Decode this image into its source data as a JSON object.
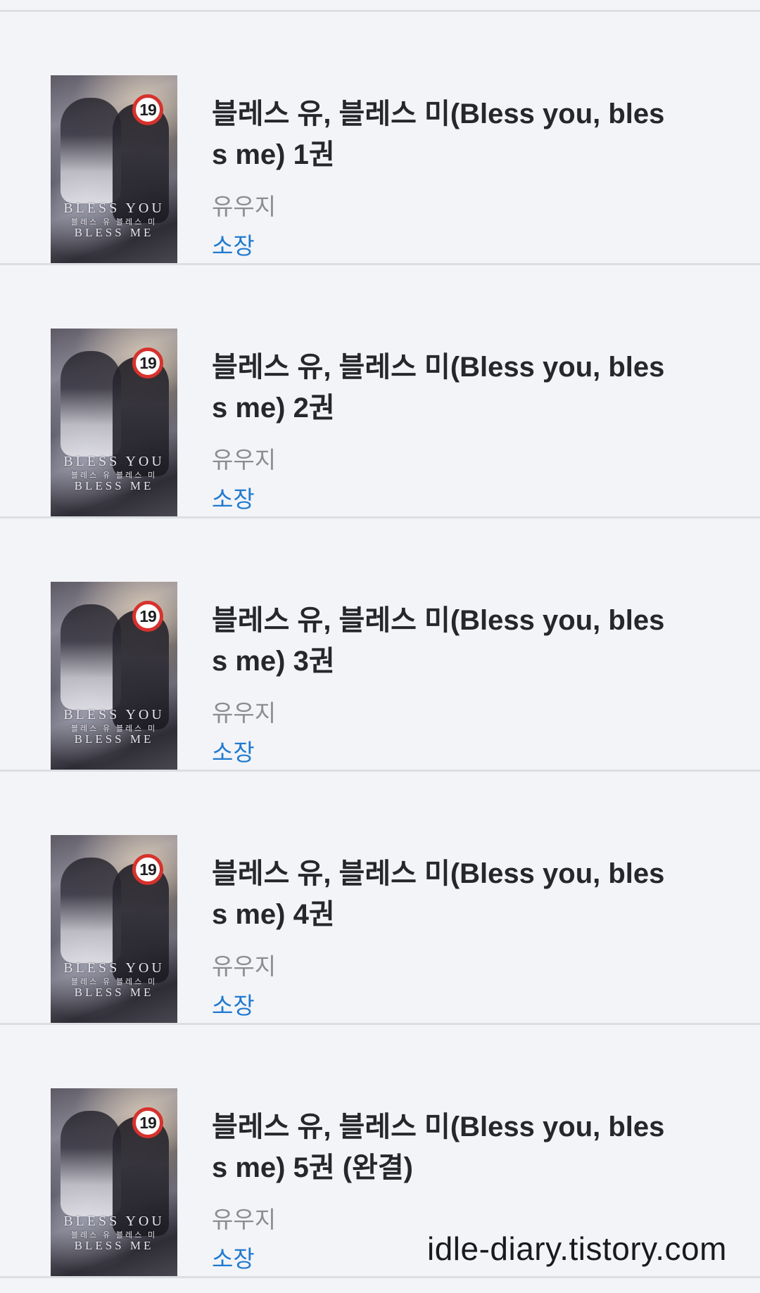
{
  "rating_badge": "19",
  "cover_text": {
    "title": "BLESS YOU",
    "subtitle": "블레스 유 블레스 미",
    "title2": "BLESS ME"
  },
  "books": [
    {
      "title": "블레스 유, 블레스 미(Bless you, bless me) 1권",
      "author": "유우지",
      "status": "소장"
    },
    {
      "title": "블레스 유, 블레스 미(Bless you, bless me) 2권",
      "author": "유우지",
      "status": "소장"
    },
    {
      "title": "블레스 유, 블레스 미(Bless you, bless me) 3권",
      "author": "유우지",
      "status": "소장"
    },
    {
      "title": "블레스 유, 블레스 미(Bless you, bless me) 4권",
      "author": "유우지",
      "status": "소장"
    },
    {
      "title": "블레스 유, 블레스 미(Bless you, bless me) 5권 (완결)",
      "author": "유우지",
      "status": "소장"
    }
  ],
  "watermark": "idle-diary.tistory.com",
  "colors": {
    "background": "#f3f4f7",
    "title": "#26272b",
    "author": "#8c8d91",
    "status": "#1f7ad0",
    "badge_ring": "#d7322d"
  }
}
